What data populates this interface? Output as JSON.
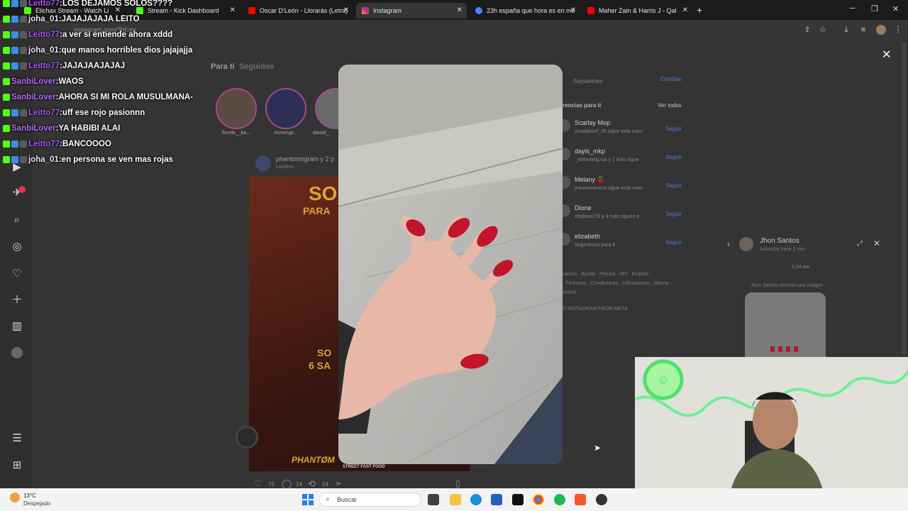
{
  "browser": {
    "tabs": [
      {
        "title": "Elichax Stream - Watch Li"
      },
      {
        "title": "Stream - Kick Dashboard"
      },
      {
        "title": "Oscar D'León - Llorarás (Letra)"
      },
      {
        "title": "Instagram"
      },
      {
        "title": "23h españa que hora es en me"
      },
      {
        "title": "Maher Zain & Harris J - Qal"
      }
    ],
    "new_tab": "+",
    "url": "instagram.com/?hl=es"
  },
  "instagram": {
    "feed_tabs": {
      "for_you": "Para ti",
      "following": "Seguidos"
    },
    "stories": [
      {
        "name": "fiorela__ba..."
      },
      {
        "name": "minvmgx..."
      },
      {
        "name": "daniel_"
      }
    ],
    "post": {
      "author": "phantomsgram y 2 p",
      "location": "Londres",
      "image_words": [
        "SO",
        "PARA",
        "SO",
        "6 SA",
        "PHANTØM",
        "STREET FAST FOOD"
      ],
      "likes": "75",
      "comments": "14",
      "shares": "14"
    },
    "profile": {
      "username": "Soysantoss",
      "switch": "Cambiar"
    },
    "suggestions_header": "rencias para ti",
    "see_all": "Ver todos",
    "follow_label": "Seguir",
    "suggestions": [
      {
        "name": "Scarlay Mop",
        "sub": "josadaniell_26 sigue esta cuen"
      },
      {
        "name": "dayis_mkp",
        "sub": "_streaming.coi y 1 más sigue"
      },
      {
        "name": "Melany 🍒",
        "sub": "jesusrontinoco sigue esta cuen"
      },
      {
        "name": "Dione",
        "sub": "eltabian179 y 4 más siguen e"
      },
      {
        "name": "elizabeth",
        "sub": "Sugerencia para ti"
      }
    ],
    "footer_links": [
      "cación · Ayuda · Prensa · API · Empleo ·",
      "· Términos · Condiciones · Ubicaciones · Idioma ·",
      "erified"
    ],
    "copyright": "© INSTAGRAM FROM META",
    "dm": {
      "name": "Jhon Santos",
      "status": "Activo(a) hace 1 min",
      "time": "2:24 am",
      "message": "Jhon Santos reenvió una imagen"
    }
  },
  "chat": [
    {
      "user": "Leitto77",
      "color": "#a855f7",
      "msg": "LOS DEJAMOS SOLOS????"
    },
    {
      "user": "joha_01",
      "color": "#e9e2ff",
      "msg": "JAJAJAJAJA LEITO"
    },
    {
      "user": "Leitto77",
      "color": "#a855f7",
      "msg": "a ver si entiende ahora xddd"
    },
    {
      "user": "joha_01",
      "color": "#e9e2ff",
      "msg": "que manos horribles dios jajajajja"
    },
    {
      "user": "Leitto77",
      "color": "#a855f7",
      "msg": "JAJAJAAJAJAJ"
    },
    {
      "user": "SanbiLover",
      "color": "#b36bff",
      "msg": "WAOS"
    },
    {
      "user": "SanbiLover",
      "color": "#b36bff",
      "msg": "AHORA SI MI ROLA MUSULMANA-"
    },
    {
      "user": "Leitto77",
      "color": "#a855f7",
      "msg": "uff ese rojo pasionnn"
    },
    {
      "user": "SanbiLover",
      "color": "#b36bff",
      "msg": "YA HABIBI ALAI"
    },
    {
      "user": "Leitto77",
      "color": "#a855f7",
      "msg": "BANCOOOO"
    },
    {
      "user": "joha_01",
      "color": "#e9e2ff",
      "msg": "en persona se ven mas rojas"
    }
  ],
  "taskbar": {
    "weather_temp": "13°C",
    "weather_desc": "Despejado",
    "search_placeholder": "Buscar"
  },
  "colors": {
    "kick_green": "#53fc18",
    "ig_blue": "#4c7dd0",
    "nail_red": "#c0152a"
  }
}
